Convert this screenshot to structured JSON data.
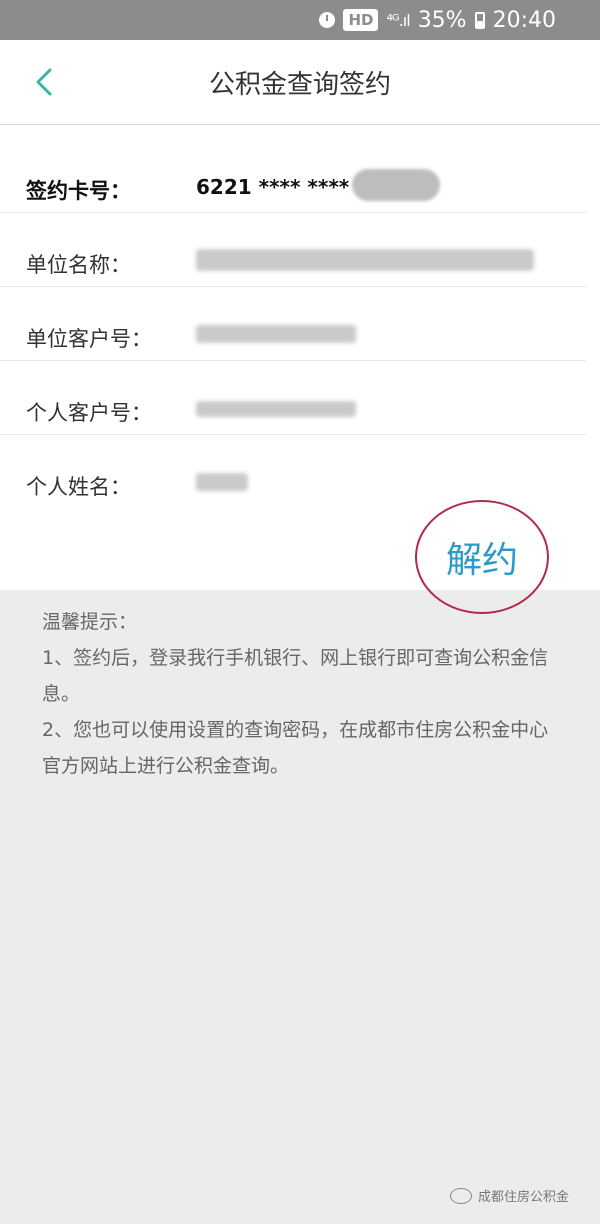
{
  "status_bar": {
    "hd": "HD",
    "signal": "⁴ᴳ.ıl",
    "battery": "35%",
    "time": "20:40"
  },
  "header": {
    "title": "公积金查询签约"
  },
  "form": {
    "card_number_label": "签约卡号：",
    "card_number_value": "6221 **** ****",
    "company_name_label": "单位名称：",
    "company_id_label": "单位客户号：",
    "personal_id_label": "个人客户号：",
    "personal_name_label": "个人姓名："
  },
  "actions": {
    "unbind": "解约"
  },
  "tips": {
    "title": "温馨提示：",
    "line1": "1、签约后，登录我行手机银行、网上银行即可查询公积金信息。",
    "line2": "2、您也可以使用设置的查询密码，在成都市住房公积金中心官方网站上进行公积金查询。"
  },
  "watermark": {
    "text": "成都住房公积金"
  },
  "colors": {
    "accent": "#2b9ac9",
    "circle": "#b02a4a",
    "back_arrow": "#3ab3a8"
  }
}
